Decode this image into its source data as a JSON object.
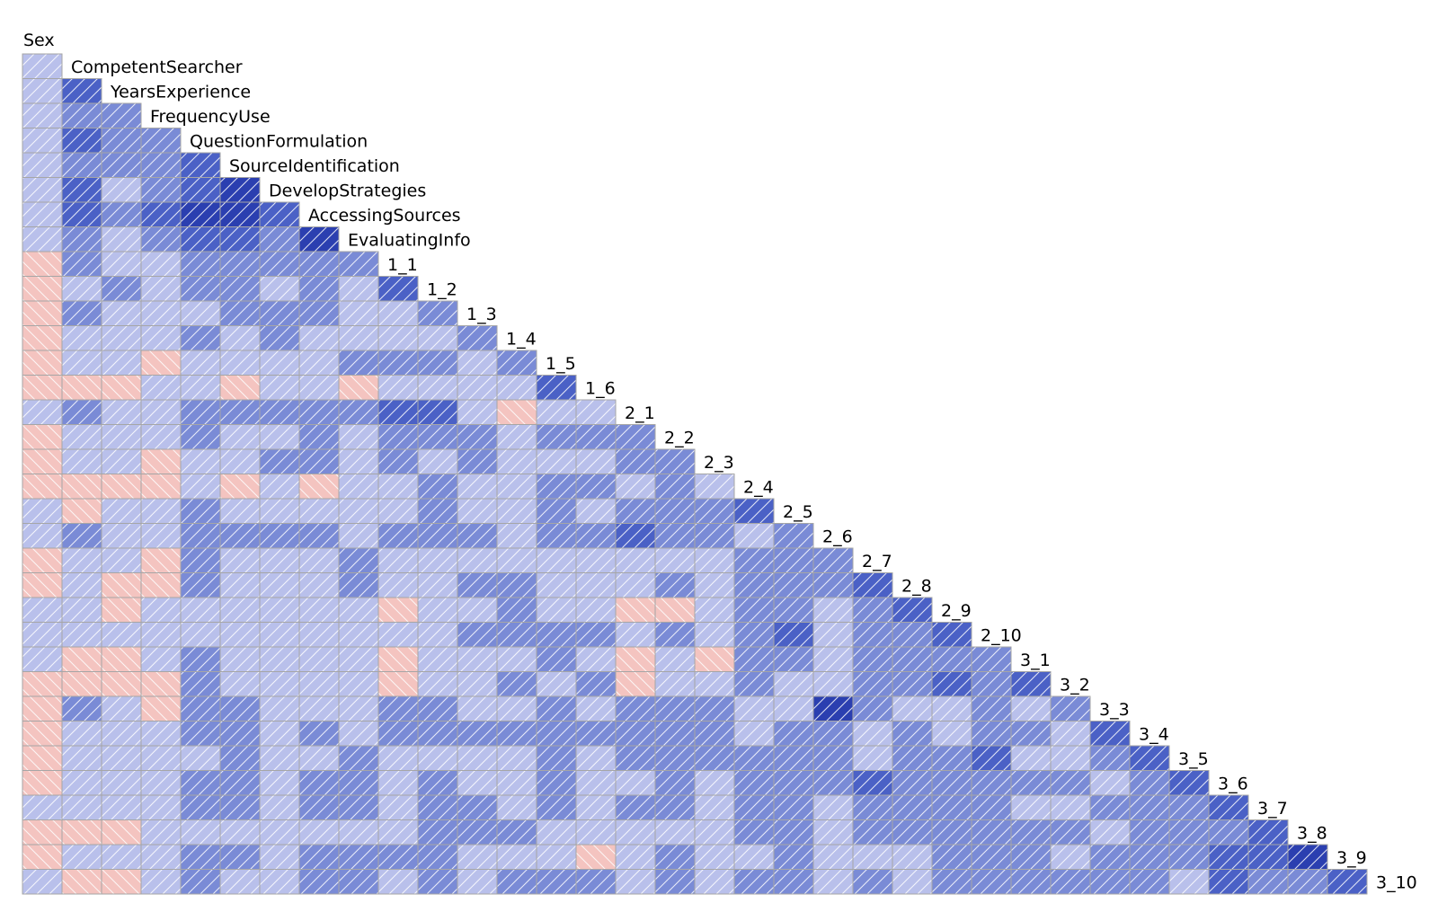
{
  "chart_data": {
    "type": "heatmap",
    "subtype": "corrgram-lower-triangle",
    "title": "",
    "variables": [
      "Sex",
      "CompetentSearcher",
      "YearsExperience",
      "FrequencyUse",
      "QuestionFormulation",
      "SourceIdentification",
      "DevelopStrategies",
      "AccessingSources",
      "EvaluatingInfo",
      "1_1",
      "1_2",
      "1_3",
      "1_4",
      "1_5",
      "1_6",
      "2_1",
      "2_2",
      "2_3",
      "2_4",
      "2_5",
      "2_6",
      "2_7",
      "2_8",
      "2_9",
      "2_10",
      "3_1",
      "3_2",
      "3_3",
      "3_4",
      "3_5",
      "3_6",
      "3_7",
      "3_8",
      "3_9",
      "3_10"
    ],
    "value_note": "Approximate correlations estimated from shading bins (negative = pink, back-hatched; positive = blue, forward-hatched; darker = stronger).",
    "value_range": [
      -1,
      1
    ],
    "matrix_lower": [
      [
        0.15
      ],
      [
        0.15,
        0.55
      ],
      [
        0.15,
        0.35,
        0.35
      ],
      [
        0.15,
        0.55,
        0.35,
        0.35
      ],
      [
        0.15,
        0.35,
        0.35,
        0.35,
        0.55
      ],
      [
        0.15,
        0.55,
        0.15,
        0.35,
        0.55,
        0.75
      ],
      [
        0.15,
        0.55,
        0.35,
        0.55,
        0.75,
        0.75,
        0.55
      ],
      [
        0.15,
        0.35,
        0.15,
        0.35,
        0.55,
        0.55,
        0.35,
        0.75
      ],
      [
        -0.1,
        0.35,
        0.15,
        0.15,
        0.35,
        0.35,
        0.35,
        0.35,
        0.35
      ],
      [
        -0.1,
        0.15,
        0.35,
        0.15,
        0.35,
        0.35,
        0.15,
        0.35,
        0.15,
        0.55
      ],
      [
        -0.1,
        0.35,
        0.15,
        0.15,
        0.15,
        0.35,
        0.35,
        0.35,
        0.15,
        0.15,
        0.35
      ],
      [
        -0.1,
        0.15,
        0.15,
        0.15,
        0.35,
        0.15,
        0.35,
        0.15,
        0.15,
        0.15,
        0.15,
        0.35
      ],
      [
        -0.1,
        0.15,
        0.15,
        -0.1,
        0.15,
        0.15,
        0.15,
        0.15,
        0.35,
        0.35,
        0.35,
        0.15,
        0.35
      ],
      [
        -0.1,
        -0.1,
        -0.1,
        0.15,
        0.15,
        -0.1,
        0.15,
        0.15,
        -0.1,
        0.15,
        0.15,
        0.15,
        0.15,
        0.55
      ],
      [
        0.15,
        0.35,
        0.15,
        0.15,
        0.35,
        0.35,
        0.35,
        0.35,
        0.35,
        0.55,
        0.55,
        0.15,
        -0.1,
        0.15,
        0.15
      ],
      [
        -0.1,
        0.15,
        0.15,
        0.15,
        0.35,
        0.15,
        0.15,
        0.35,
        0.15,
        0.35,
        0.35,
        0.35,
        0.15,
        0.35,
        0.35,
        0.35
      ],
      [
        -0.1,
        0.15,
        0.15,
        -0.1,
        0.15,
        0.15,
        0.35,
        0.35,
        0.15,
        0.35,
        0.15,
        0.35,
        0.15,
        0.15,
        0.15,
        0.35,
        0.35
      ],
      [
        -0.1,
        -0.1,
        -0.1,
        -0.1,
        0.15,
        -0.1,
        0.15,
        -0.1,
        0.15,
        0.15,
        0.35,
        0.15,
        0.15,
        0.35,
        0.35,
        0.15,
        0.35,
        0.15
      ],
      [
        0.15,
        -0.1,
        0.15,
        0.15,
        0.35,
        0.15,
        0.15,
        0.15,
        0.15,
        0.15,
        0.35,
        0.15,
        0.15,
        0.35,
        0.15,
        0.35,
        0.35,
        0.35,
        0.55
      ],
      [
        0.15,
        0.35,
        0.15,
        0.15,
        0.35,
        0.35,
        0.35,
        0.35,
        0.15,
        0.35,
        0.35,
        0.35,
        0.15,
        0.35,
        0.35,
        0.55,
        0.35,
        0.35,
        0.15,
        0.35
      ],
      [
        -0.1,
        0.15,
        0.15,
        -0.1,
        0.35,
        0.15,
        0.15,
        0.15,
        0.35,
        0.15,
        0.15,
        0.15,
        0.15,
        0.15,
        0.15,
        0.15,
        0.15,
        0.15,
        0.35,
        0.35,
        0.35
      ],
      [
        -0.1,
        0.15,
        -0.1,
        -0.1,
        0.35,
        0.15,
        0.15,
        0.15,
        0.35,
        0.15,
        0.15,
        0.35,
        0.35,
        0.15,
        0.15,
        0.15,
        0.35,
        0.15,
        0.35,
        0.35,
        0.35,
        0.55
      ],
      [
        0.15,
        0.15,
        -0.1,
        0.15,
        0.15,
        0.15,
        0.15,
        0.15,
        0.15,
        -0.1,
        0.15,
        0.15,
        0.35,
        0.15,
        0.15,
        -0.1,
        -0.1,
        0.15,
        0.35,
        0.35,
        0.15,
        0.35,
        0.55
      ],
      [
        0.15,
        0.15,
        0.15,
        0.15,
        0.15,
        0.15,
        0.15,
        0.15,
        0.15,
        0.15,
        0.15,
        0.35,
        0.35,
        0.35,
        0.35,
        0.15,
        0.35,
        0.15,
        0.35,
        0.55,
        0.15,
        0.35,
        0.35,
        0.55
      ],
      [
        0.15,
        -0.1,
        -0.1,
        0.15,
        0.35,
        0.15,
        0.15,
        0.15,
        0.15,
        -0.1,
        0.15,
        0.15,
        0.15,
        0.35,
        0.15,
        -0.1,
        0.15,
        -0.1,
        0.35,
        0.35,
        0.15,
        0.35,
        0.35,
        0.35,
        0.35
      ],
      [
        -0.1,
        -0.1,
        -0.1,
        -0.1,
        0.35,
        0.15,
        0.15,
        0.15,
        0.15,
        -0.1,
        0.15,
        0.15,
        0.35,
        0.15,
        0.35,
        -0.1,
        0.15,
        0.15,
        0.35,
        0.15,
        0.15,
        0.35,
        0.35,
        0.55,
        0.35,
        0.55
      ],
      [
        -0.1,
        0.35,
        0.15,
        -0.1,
        0.35,
        0.35,
        0.15,
        0.15,
        0.15,
        0.35,
        0.35,
        0.15,
        0.15,
        0.35,
        0.15,
        0.35,
        0.35,
        0.35,
        0.15,
        0.15,
        0.75,
        0.35,
        0.15,
        0.15,
        0.35,
        0.15,
        0.35
      ],
      [
        -0.1,
        0.15,
        0.15,
        0.15,
        0.35,
        0.35,
        0.15,
        0.35,
        0.15,
        0.35,
        0.35,
        0.35,
        0.35,
        0.35,
        0.35,
        0.35,
        0.35,
        0.35,
        0.15,
        0.35,
        0.35,
        0.15,
        0.35,
        0.15,
        0.35,
        0.35,
        0.15,
        0.55
      ],
      [
        -0.1,
        0.15,
        0.15,
        0.15,
        0.15,
        0.35,
        0.15,
        0.15,
        0.35,
        0.15,
        0.15,
        0.15,
        0.15,
        0.35,
        0.15,
        0.35,
        0.35,
        0.35,
        0.35,
        0.35,
        0.35,
        0.15,
        0.35,
        0.35,
        0.55,
        0.15,
        0.15,
        0.35,
        0.55
      ],
      [
        -0.1,
        0.15,
        0.15,
        0.15,
        0.35,
        0.35,
        0.15,
        0.35,
        0.35,
        0.15,
        0.35,
        0.15,
        0.15,
        0.35,
        0.15,
        0.15,
        0.35,
        0.15,
        0.35,
        0.35,
        0.35,
        0.55,
        0.35,
        0.35,
        0.35,
        0.35,
        0.35,
        0.15,
        0.35,
        0.55
      ],
      [
        0.15,
        0.15,
        0.15,
        0.15,
        0.35,
        0.35,
        0.15,
        0.35,
        0.35,
        0.15,
        0.35,
        0.35,
        0.15,
        0.35,
        0.15,
        0.35,
        0.35,
        0.15,
        0.35,
        0.35,
        0.15,
        0.35,
        0.35,
        0.35,
        0.35,
        0.15,
        0.15,
        0.35,
        0.35,
        0.35,
        0.55
      ],
      [
        -0.1,
        -0.1,
        -0.1,
        0.15,
        0.15,
        0.15,
        0.15,
        0.15,
        0.15,
        0.15,
        0.35,
        0.35,
        0.35,
        0.15,
        0.15,
        0.15,
        0.15,
        0.15,
        0.35,
        0.35,
        0.15,
        0.35,
        0.35,
        0.35,
        0.35,
        0.35,
        0.35,
        0.15,
        0.35,
        0.35,
        0.35,
        0.55
      ],
      [
        -0.1,
        0.15,
        0.15,
        0.15,
        0.35,
        0.35,
        0.15,
        0.35,
        0.35,
        0.35,
        0.35,
        0.15,
        0.15,
        0.15,
        -0.1,
        0.15,
        0.35,
        0.15,
        0.15,
        0.35,
        0.15,
        0.15,
        0.15,
        0.35,
        0.35,
        0.35,
        0.15,
        0.35,
        0.35,
        0.35,
        0.55,
        0.55,
        0.75
      ],
      [
        0.15,
        -0.1,
        -0.1,
        0.15,
        0.35,
        0.15,
        0.15,
        0.35,
        0.35,
        0.15,
        0.35,
        0.15,
        0.35,
        0.35,
        0.35,
        0.15,
        0.35,
        0.15,
        0.35,
        0.35,
        0.15,
        0.35,
        0.15,
        0.35,
        0.35,
        0.35,
        0.35,
        0.35,
        0.35,
        0.15,
        0.55,
        0.35,
        0.35,
        0.55
      ]
    ],
    "color_scale": {
      "negative": "#f4c4c0",
      "positive_bins": [
        {
          "min": 0.0,
          "max": 0.25,
          "color": "#b9c0eb"
        },
        {
          "min": 0.25,
          "max": 0.45,
          "color": "#7a8bd6"
        },
        {
          "min": 0.45,
          "max": 0.65,
          "color": "#4b61c6"
        },
        {
          "min": 0.65,
          "max": 1.0,
          "color": "#2b3fb0"
        }
      ],
      "grid_color": "#a6a6a6",
      "hatch_color": "#ffffff"
    },
    "legend": "none",
    "grid": true
  }
}
